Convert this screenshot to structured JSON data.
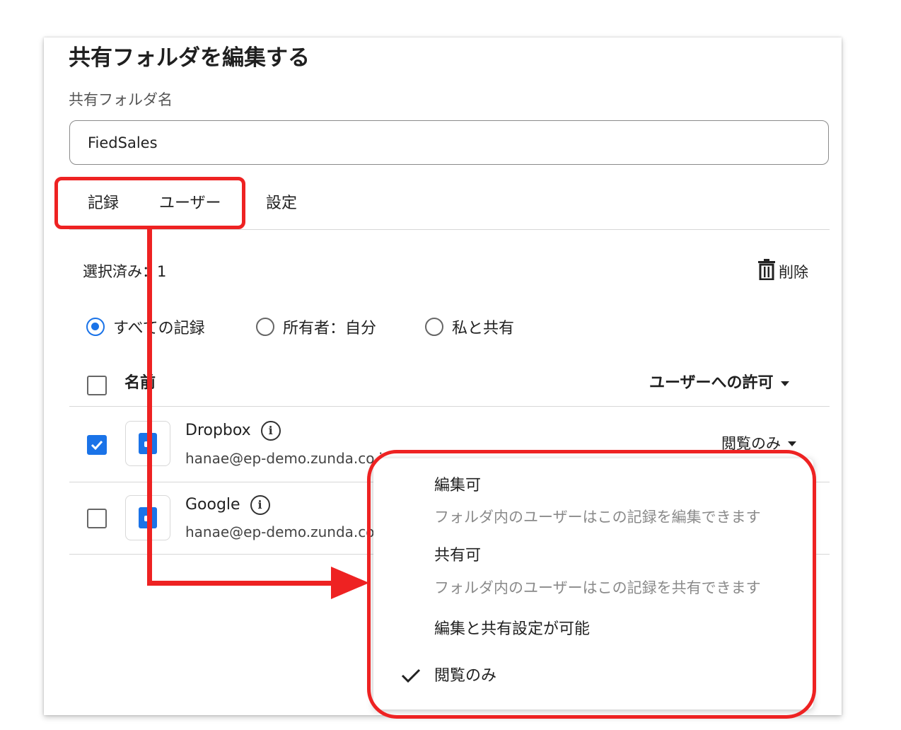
{
  "dialog": {
    "title": "共有フォルダを編集する",
    "folder_name_label": "共有フォルダ名",
    "folder_name_value": "FiedSales"
  },
  "tabs": [
    {
      "label": "記録"
    },
    {
      "label": "ユーザー"
    },
    {
      "label": "設定"
    }
  ],
  "toolbar": {
    "selected_text": "選択済み：1",
    "delete_label": "削除"
  },
  "filters": [
    {
      "label": "すべての記録",
      "selected": true
    },
    {
      "label": "所有者：自分",
      "selected": false
    },
    {
      "label": "私と共有",
      "selected": false
    }
  ],
  "table": {
    "header_name": "名前",
    "header_permission": "ユーザーへの許可",
    "rows": [
      {
        "name": "Dropbox",
        "email": "hanae@ep-demo.zunda.co.jp",
        "email_visible": "hanae@ep-demo.zunda.co.i",
        "checked": true,
        "permission": "閲覧のみ"
      },
      {
        "name": "Google",
        "email_visible": "hanae@ep-demo.zunda.co",
        "checked": false
      }
    ]
  },
  "permission_menu": {
    "items": [
      {
        "title": "編集可",
        "description": "フォルダ内のユーザーはこの記録を編集できます"
      },
      {
        "title": "共有可",
        "description": "フォルダ内のユーザーはこの記録を共有できます"
      },
      {
        "title": "編集と共有設定が可能"
      },
      {
        "title": "閲覧のみ",
        "checked": true
      }
    ]
  },
  "icons": {
    "delete": "trash-icon",
    "info": "info-icon",
    "check": "check-icon",
    "dropdown": "caret-down-icon",
    "app": "app-logo-icon"
  },
  "colors": {
    "accent": "#1a73e8",
    "annotation": "#ee2222"
  }
}
